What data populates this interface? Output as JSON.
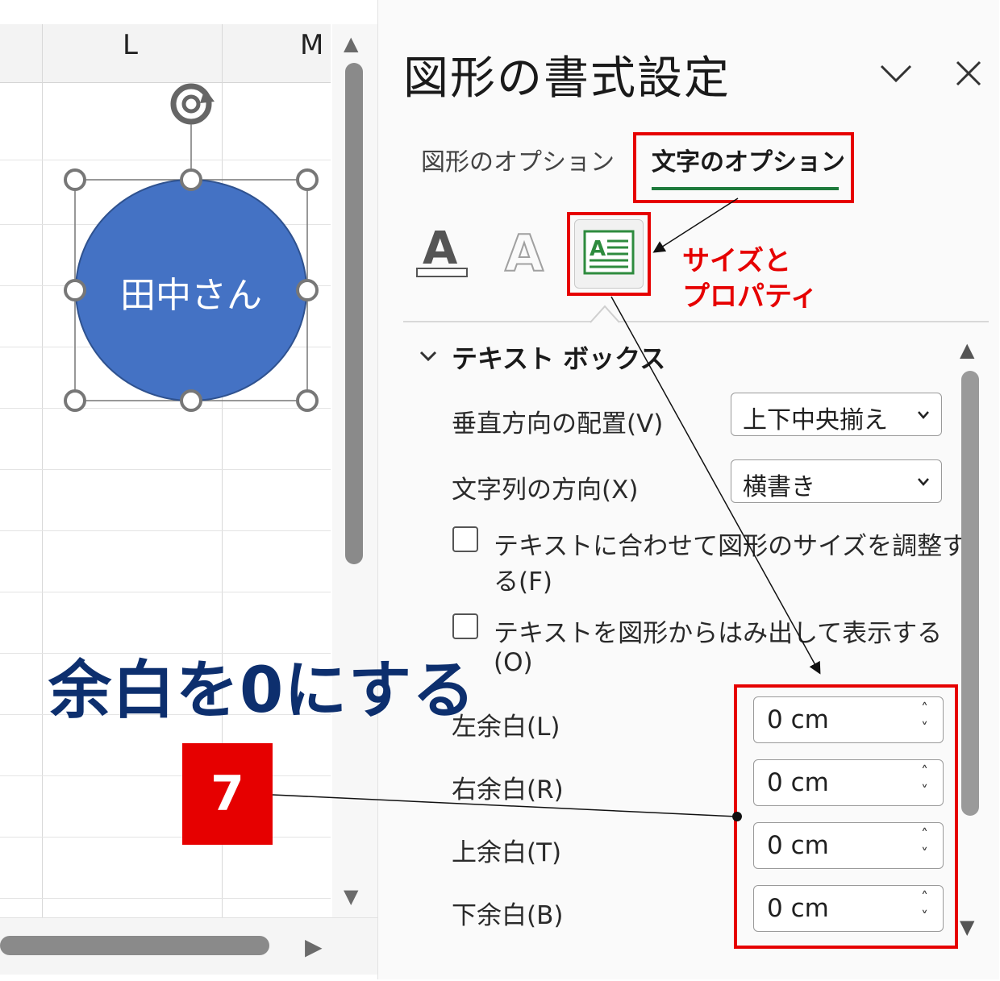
{
  "spreadsheet": {
    "columns": [
      "L",
      "M"
    ],
    "shape_text": "田中さん",
    "shape_color": "#4472c4"
  },
  "pane": {
    "title": "図形の書式設定",
    "tabs": [
      {
        "label": "図形のオプション",
        "active": false
      },
      {
        "label": "文字のオプション",
        "active": true
      }
    ],
    "icons": [
      "text-fill-icon",
      "text-outline-icon",
      "textbox-icon"
    ],
    "section_title": "テキスト ボックス",
    "vertical_align_label": "垂直方向の配置(V)",
    "vertical_align_value": "上下中央揃え",
    "text_direction_label": "文字列の方向(X)",
    "text_direction_value": "横書き",
    "autofit_label_line1": "テキストに合わせて図形のサイズを調整す",
    "autofit_label_line2": "る(F)",
    "overflow_label_line1": "テキストを図形からはみ出して表示する",
    "overflow_label_line2": "(O)",
    "margins": [
      {
        "label": "左余白(L)",
        "value": "0 cm"
      },
      {
        "label": "右余白(R)",
        "value": "0 cm"
      },
      {
        "label": "上余白(T)",
        "value": "0 cm"
      },
      {
        "label": "下余白(B)",
        "value": "0 cm"
      }
    ]
  },
  "annotations": {
    "size_property_line1": "サイズと",
    "size_property_line2": "プロパティ",
    "margin_instruction": "余白を0にする",
    "step_number": "7",
    "accent_red": "#e60000",
    "accent_blue": "#0d2f6e"
  }
}
